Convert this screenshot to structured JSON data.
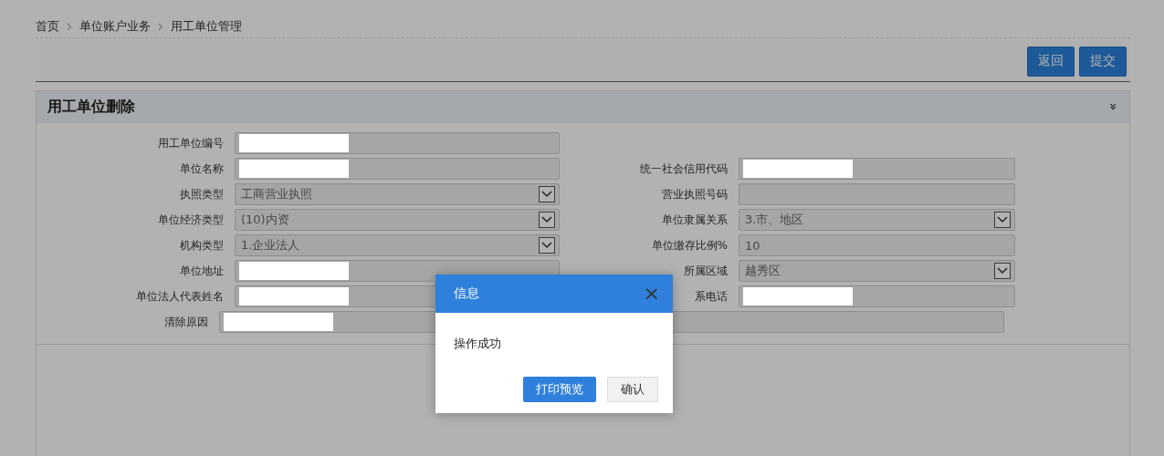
{
  "breadcrumb": [
    {
      "label": "首页"
    },
    {
      "label": "单位账户业务"
    },
    {
      "label": "用工单位管理"
    }
  ],
  "toolbar": {
    "buttons": [
      {
        "label": "返回"
      },
      {
        "label": "提交"
      }
    ]
  },
  "panel": {
    "title": "用工单位删除",
    "collapse_icon": "»",
    "rows": [
      {
        "left": {
          "label": "用工单位编号",
          "kind": "text",
          "redacted": true
        }
      },
      {
        "left": {
          "label": "单位名称",
          "kind": "text",
          "redacted": true
        },
        "right": {
          "label": "统一社会信用代码",
          "kind": "text",
          "redacted": true
        }
      },
      {
        "left": {
          "label": "执照类型",
          "kind": "select",
          "value": "工商营业执照"
        },
        "right": {
          "label": "营业执照号码",
          "kind": "text"
        }
      },
      {
        "left": {
          "label": "单位经济类型",
          "kind": "select",
          "value": "(10)内资"
        },
        "right": {
          "label": "单位隶属关系",
          "kind": "select",
          "value": "3.市、地区"
        }
      },
      {
        "left": {
          "label": "机构类型",
          "kind": "select",
          "value": "1.企业法人"
        },
        "right": {
          "label": "单位缴存比例%",
          "kind": "text",
          "value": "10"
        }
      },
      {
        "left": {
          "label": "单位地址",
          "kind": "text",
          "redacted": true
        },
        "right": {
          "label": "所属区域",
          "kind": "select",
          "value": "越秀区"
        }
      },
      {
        "left": {
          "label": "单位法人代表姓名",
          "kind": "text",
          "redacted": true
        },
        "right": {
          "label": "系电话",
          "kind": "text",
          "redacted": true
        }
      }
    ],
    "wide": {
      "label": "清除原因",
      "kind": "text",
      "redacted": true
    }
  },
  "dialog": {
    "title": "信息",
    "close": "×",
    "message": "操作成功",
    "buttons": [
      {
        "label": "打印预览",
        "kind": "primary"
      },
      {
        "label": "确认",
        "kind": "default"
      }
    ]
  }
}
